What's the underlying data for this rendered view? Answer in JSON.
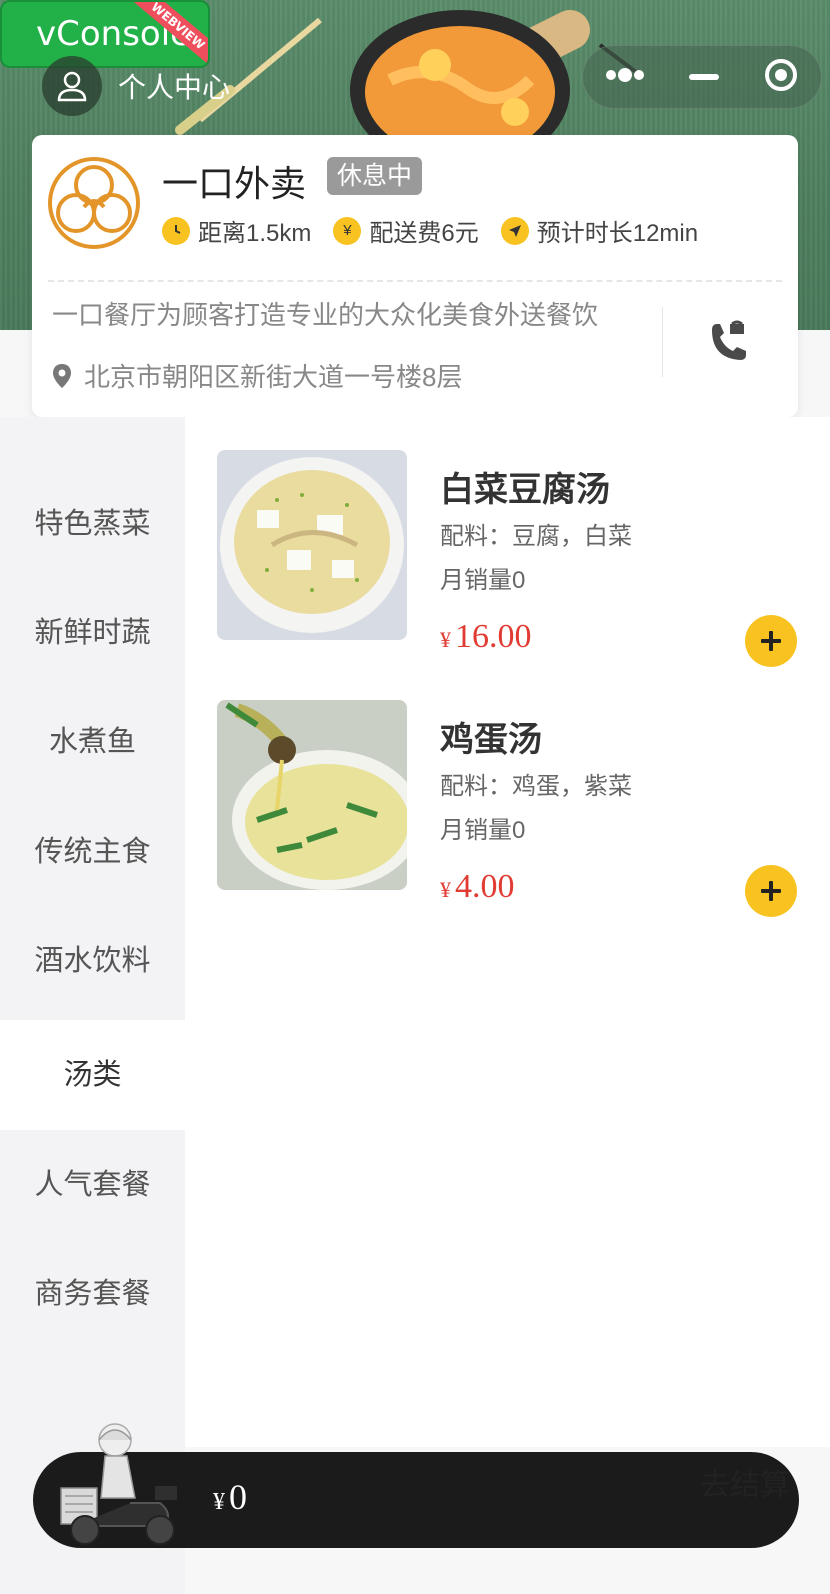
{
  "vconsole": {
    "label": "vConsole",
    "ribbon": "WEBVIEW"
  },
  "profile": {
    "label": "个人中心"
  },
  "shop": {
    "name": "一口外卖",
    "status": "休息中",
    "meta": {
      "distance": "距离1.5km",
      "delivery_fee": "配送费6元",
      "eta": "预计时长12min"
    },
    "description": "一口餐厅为顾客打造专业的大众化美食外送餐饮",
    "address": "北京市朝阳区新街大道一号楼8层"
  },
  "categories": [
    {
      "label": "特色蒸菜"
    },
    {
      "label": "新鲜时蔬"
    },
    {
      "label": "水煮鱼"
    },
    {
      "label": "传统主食"
    },
    {
      "label": "酒水饮料"
    },
    {
      "label": "汤类",
      "active": true
    },
    {
      "label": "人气套餐"
    },
    {
      "label": "商务套餐"
    }
  ],
  "dishes": [
    {
      "name": "白菜豆腐汤",
      "ingredients": "配料：豆腐，白菜",
      "sales": "月销量0",
      "currency": "¥",
      "price": "16.00"
    },
    {
      "name": "鸡蛋汤",
      "ingredients": "配料：鸡蛋，紫菜",
      "sales": "月销量0",
      "currency": "¥",
      "price": "4.00"
    }
  ],
  "cart": {
    "currency": "¥",
    "total": "0",
    "checkout_label": "去结算"
  },
  "colors": {
    "accent": "#f8c220",
    "price": "#e03c33",
    "vconsole": "#22b148",
    "header": "#5a8c6a"
  },
  "icons": [
    "user-icon",
    "more-dots-icon",
    "minimize-icon",
    "close-target-icon",
    "clock-icon",
    "yen-icon",
    "navigation-icon",
    "location-pin-icon",
    "phone-icon",
    "plus-icon"
  ]
}
